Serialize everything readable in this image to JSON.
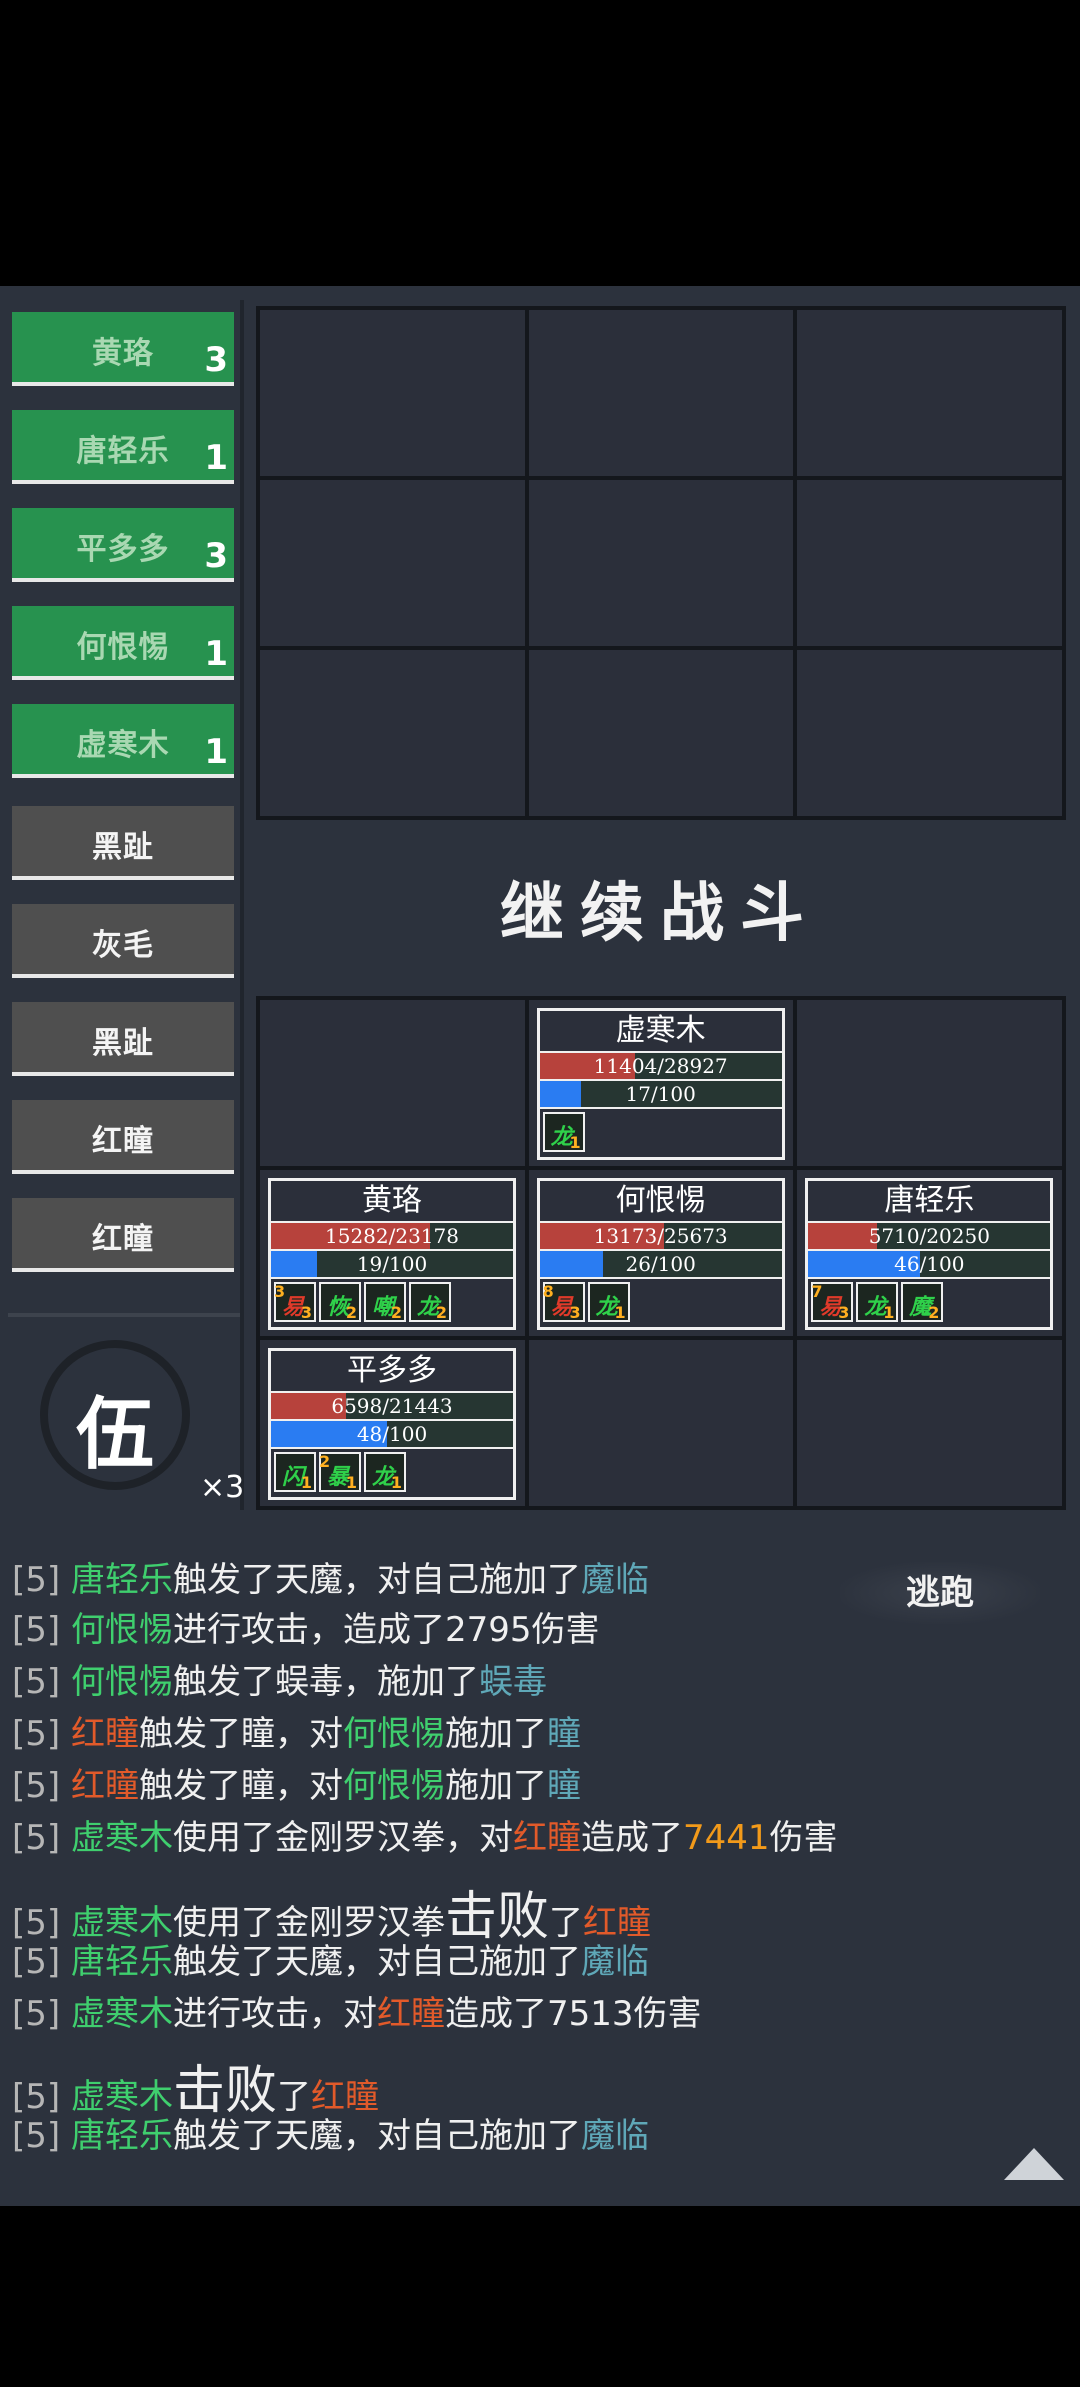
{
  "sidebar": {
    "units": [
      {
        "name": "黄珞",
        "count": "3",
        "side": "ally"
      },
      {
        "name": "唐轻乐",
        "count": "1",
        "side": "ally"
      },
      {
        "name": "平多多",
        "count": "3",
        "side": "ally"
      },
      {
        "name": "何恨惕",
        "count": "1",
        "side": "ally"
      },
      {
        "name": "虚寒木",
        "count": "1",
        "side": "ally"
      },
      {
        "name": "黑趾",
        "count": "",
        "side": "enemy"
      },
      {
        "name": "灰毛",
        "count": "",
        "side": "enemy"
      },
      {
        "name": "黑趾",
        "count": "",
        "side": "enemy"
      },
      {
        "name": "红瞳",
        "count": "",
        "side": "enemy"
      },
      {
        "name": "红瞳",
        "count": "",
        "side": "enemy"
      }
    ],
    "team_glyph": "伍",
    "team_multiplier": "×3"
  },
  "continue_button": "继续战斗",
  "escape_button": "逃跑",
  "units": {
    "xuhanmu": {
      "name": "虚寒木",
      "hp": "11404/28927",
      "hp_frac": 0.394,
      "mp": "17/100",
      "mp_frac": 0.17,
      "buffs": [
        {
          "glyph": "龙",
          "color": "#2fd14a",
          "num": "1",
          "stack": ""
        }
      ]
    },
    "huangluo": {
      "name": "黄珞",
      "hp": "15282/23178",
      "hp_frac": 0.659,
      "mp": "19/100",
      "mp_frac": 0.19,
      "buffs": [
        {
          "glyph": "易",
          "color": "#e03a2a",
          "num": "3",
          "stack": "3"
        },
        {
          "glyph": "恢",
          "color": "#2fd14a",
          "num": "2",
          "stack": ""
        },
        {
          "glyph": "嘲",
          "color": "#2fd14a",
          "num": "2",
          "stack": ""
        },
        {
          "glyph": "龙",
          "color": "#2fd14a",
          "num": "2",
          "stack": ""
        }
      ]
    },
    "hehenti": {
      "name": "何恨惕",
      "hp": "13173/25673",
      "hp_frac": 0.513,
      "mp": "26/100",
      "mp_frac": 0.26,
      "buffs": [
        {
          "glyph": "易",
          "color": "#e03a2a",
          "num": "3",
          "stack": "8"
        },
        {
          "glyph": "龙",
          "color": "#2fd14a",
          "num": "1",
          "stack": ""
        }
      ]
    },
    "tangqingle": {
      "name": "唐轻乐",
      "hp": "5710/20250",
      "hp_frac": 0.282,
      "mp": "46/100",
      "mp_frac": 0.46,
      "buffs": [
        {
          "glyph": "易",
          "color": "#e03a2a",
          "num": "3",
          "stack": "7"
        },
        {
          "glyph": "龙",
          "color": "#2fd14a",
          "num": "1",
          "stack": ""
        },
        {
          "glyph": "魔",
          "color": "#2fd14a",
          "num": "2",
          "stack": ""
        }
      ]
    },
    "pingduoduo": {
      "name": "平多多",
      "hp": "6598/21443",
      "hp_frac": 0.308,
      "mp": "48/100",
      "mp_frac": 0.48,
      "buffs": [
        {
          "glyph": "闪",
          "color": "#2fd14a",
          "num": "1",
          "stack": ""
        },
        {
          "glyph": "暴",
          "color": "#2fd14a",
          "num": "1",
          "stack": "2"
        },
        {
          "glyph": "龙",
          "color": "#2fd14a",
          "num": "1",
          "stack": ""
        }
      ]
    }
  },
  "log": [
    {
      "round": "[5]",
      "big": false,
      "parts": [
        {
          "t": "唐轻乐",
          "c": "ally"
        },
        {
          "t": "触发了天魔，对自己施加了",
          "c": ""
        },
        {
          "t": "魔临",
          "c": "skill"
        }
      ]
    },
    {
      "round": "[5]",
      "big": false,
      "parts": [
        {
          "t": "何恨惕",
          "c": "ally"
        },
        {
          "t": "进行攻击，造成了2795伤害",
          "c": ""
        }
      ]
    },
    {
      "round": "[5]",
      "big": false,
      "parts": [
        {
          "t": "何恨惕",
          "c": "ally"
        },
        {
          "t": "触发了蜈毒，施加了",
          "c": ""
        },
        {
          "t": "蜈毒",
          "c": "skill"
        }
      ]
    },
    {
      "round": "[5]",
      "big": false,
      "parts": [
        {
          "t": "红瞳",
          "c": "enemy"
        },
        {
          "t": "触发了瞳，对",
          "c": ""
        },
        {
          "t": "何恨惕",
          "c": "ally"
        },
        {
          "t": "施加了",
          "c": ""
        },
        {
          "t": "瞳",
          "c": "skill"
        }
      ]
    },
    {
      "round": "[5]",
      "big": false,
      "parts": [
        {
          "t": "红瞳",
          "c": "enemy"
        },
        {
          "t": "触发了瞳，对",
          "c": ""
        },
        {
          "t": "何恨惕",
          "c": "ally"
        },
        {
          "t": "施加了",
          "c": ""
        },
        {
          "t": "瞳",
          "c": "skill"
        }
      ]
    },
    {
      "round": "[5]",
      "big": false,
      "parts": [
        {
          "t": "虚寒木",
          "c": "ally"
        },
        {
          "t": "使用了金刚罗汉拳，对",
          "c": ""
        },
        {
          "t": "红瞳",
          "c": "enemy"
        },
        {
          "t": "造成了",
          "c": ""
        },
        {
          "t": "7441",
          "c": "num"
        },
        {
          "t": "伤害",
          "c": ""
        }
      ]
    },
    {
      "round": "[5]",
      "big": true,
      "parts": [
        {
          "t": "虚寒木",
          "c": "ally"
        },
        {
          "t": "使用了金刚罗汉拳",
          "c": ""
        },
        {
          "t": "击败",
          "c": "big"
        },
        {
          "t": "了",
          "c": ""
        },
        {
          "t": "红瞳",
          "c": "enemy"
        }
      ]
    },
    {
      "round": "[5]",
      "big": false,
      "parts": [
        {
          "t": "唐轻乐",
          "c": "ally"
        },
        {
          "t": "触发了天魔，对自己施加了",
          "c": ""
        },
        {
          "t": "魔临",
          "c": "skill"
        }
      ]
    },
    {
      "round": "[5]",
      "big": false,
      "parts": [
        {
          "t": "虚寒木",
          "c": "ally"
        },
        {
          "t": "进行攻击，对",
          "c": ""
        },
        {
          "t": "红瞳",
          "c": "enemy"
        },
        {
          "t": "造成了7513伤害",
          "c": ""
        }
      ]
    },
    {
      "round": "[5]",
      "big": true,
      "parts": [
        {
          "t": "虚寒木",
          "c": "ally"
        },
        {
          "t": "击败",
          "c": "big"
        },
        {
          "t": "了",
          "c": ""
        },
        {
          "t": "红瞳",
          "c": "enemy"
        }
      ]
    },
    {
      "round": "[5]",
      "big": false,
      "parts": [
        {
          "t": "唐轻乐",
          "c": "ally"
        },
        {
          "t": "触发了天魔，对自己施加了",
          "c": ""
        },
        {
          "t": "魔临",
          "c": "skill"
        }
      ]
    }
  ]
}
